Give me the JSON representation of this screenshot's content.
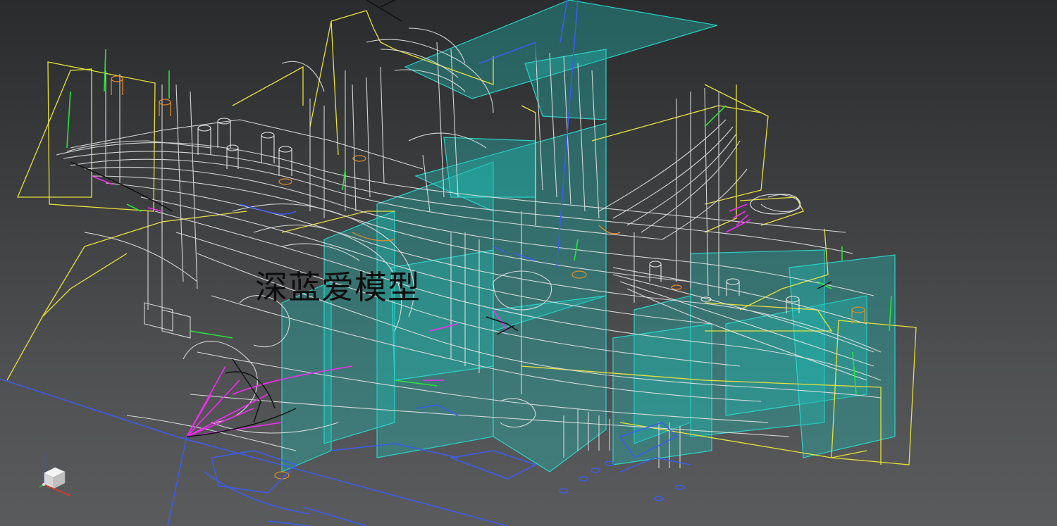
{
  "viewport": {
    "watermark_text": "深蓝爱模型",
    "mode": "wireframe",
    "view_cube_icon": "axis-gizmo-icon"
  },
  "colors": {
    "background_top": "#2a2b2d",
    "background_bottom": "#5a5b5d",
    "wire_white": "#e6e6e6",
    "wire_yellow": "#e8e23a",
    "wire_blue": "#3c5cf0",
    "wire_green": "#29e33a",
    "wire_magenta": "#f02cf0",
    "wire_orange": "#e08a2a",
    "plane_cyan": "#20b8b0",
    "wire_black": "#111111"
  }
}
